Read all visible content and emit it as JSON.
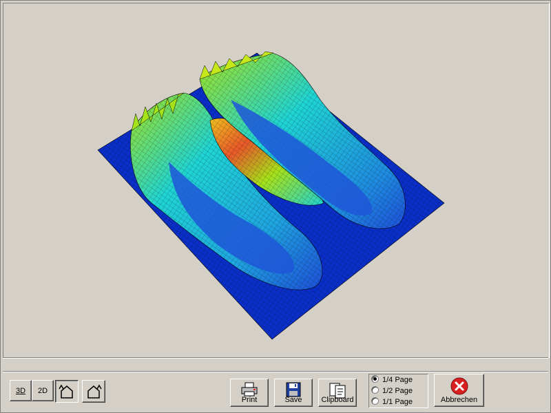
{
  "toolbar": {
    "btn_3d": "3D",
    "btn_2d": "2D",
    "print_label": "Print",
    "save_label": "Save",
    "clipboard_label": "Clipboard",
    "cancel_label": "Abbrechen",
    "page_options": [
      "1/4 Page",
      "1/2 Page",
      "1/1 Page"
    ],
    "selected_page_option": "1/4 Page"
  },
  "plot": {
    "content": "3D pressure distribution surface of two feet",
    "colors": {
      "low": "#0a2fc8",
      "mid": "#1fd4d4",
      "high": "#a6e21a",
      "peak": "#e8582a"
    }
  }
}
